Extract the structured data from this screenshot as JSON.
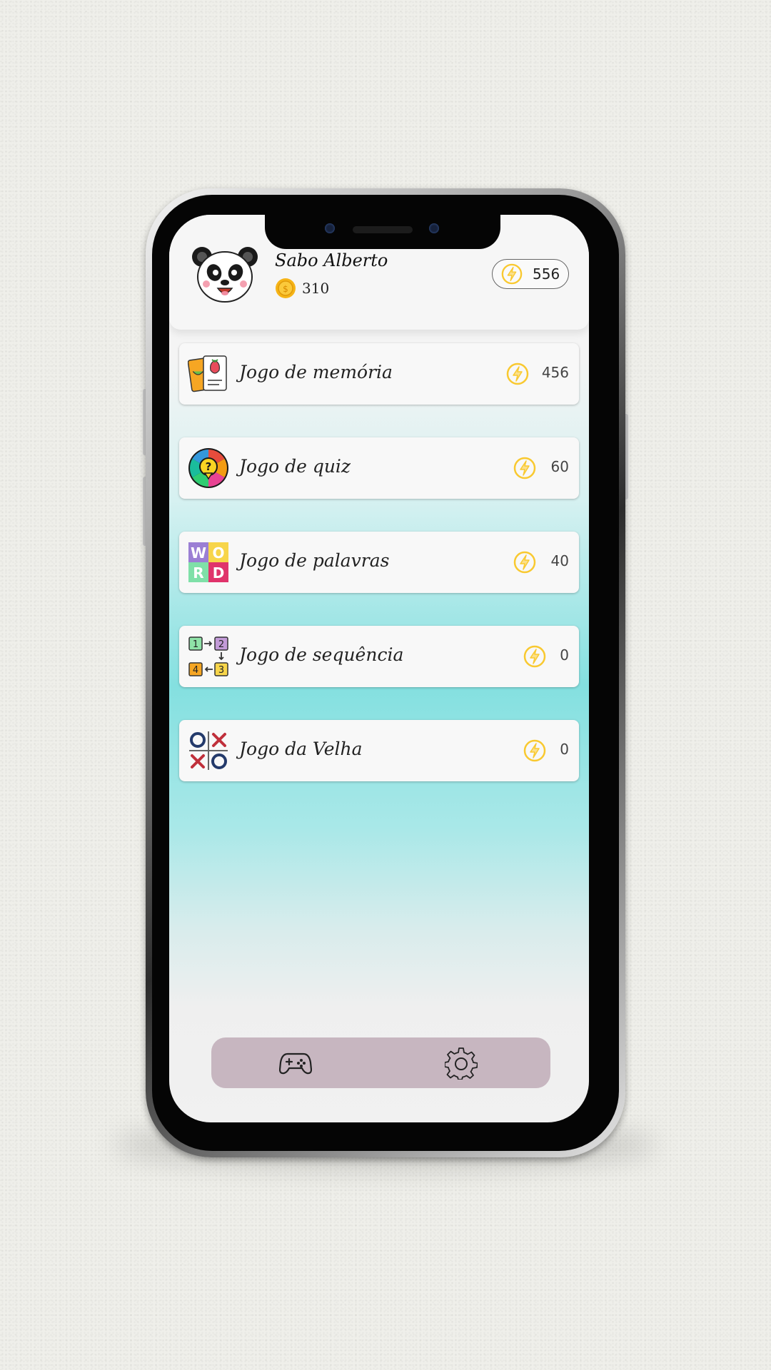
{
  "profile": {
    "name": "Sabo Alberto",
    "coins": "310",
    "energy": "556",
    "avatar_icon": "panda-avatar-icon",
    "coin_icon": "coin-icon",
    "energy_icon": "lightning-bolt-icon"
  },
  "games": [
    {
      "label": "Jogo de memória",
      "value": "456",
      "icon": "memory-cards-icon"
    },
    {
      "label": "Jogo de quiz",
      "value": "60",
      "icon": "quiz-wheel-icon"
    },
    {
      "label": "Jogo de palavras",
      "value": "40",
      "icon": "word-puzzle-icon"
    },
    {
      "label": "Jogo de sequência",
      "value": "0",
      "icon": "sequence-icon"
    },
    {
      "label": "Jogo da Velha",
      "value": "0",
      "icon": "tic-tac-toe-icon"
    }
  ],
  "navbar": {
    "items": [
      {
        "icon": "gamepad-icon"
      },
      {
        "icon": "gear-icon"
      }
    ]
  },
  "colors": {
    "accent_energy": "#f9c930",
    "coin": "#f6b417",
    "navbar": "#c7b6c0",
    "teal": "#84e0e0"
  }
}
